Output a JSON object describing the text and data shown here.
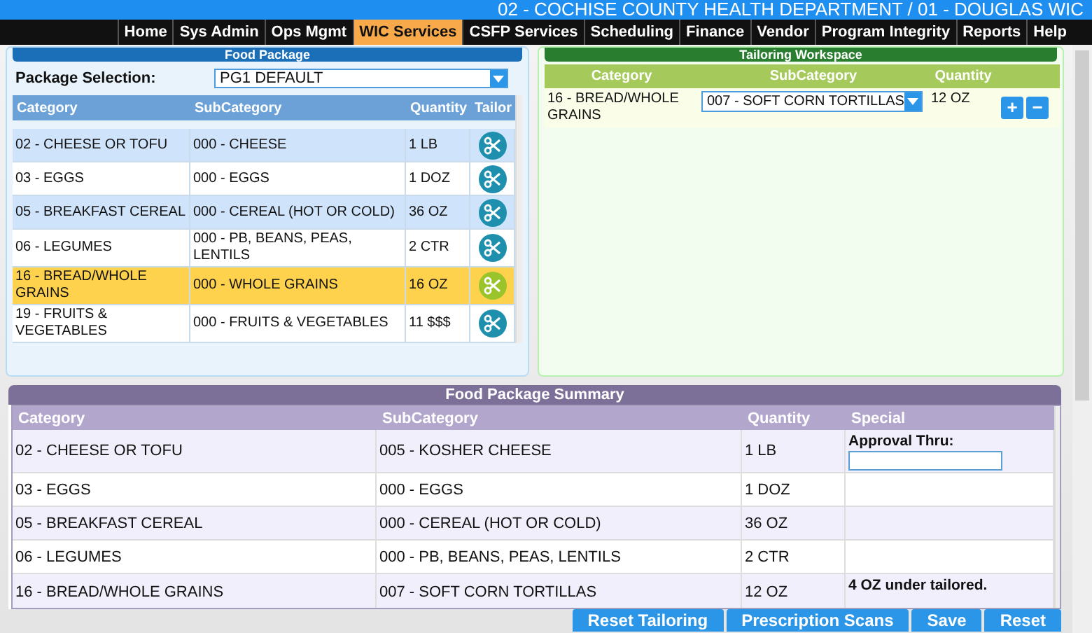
{
  "header": {
    "title": "02 - COCHISE COUNTY HEALTH DEPARTMENT / 01 - DOUGLAS WIC"
  },
  "nav": [
    {
      "label": "Home",
      "selected": false
    },
    {
      "label": "Sys Admin",
      "selected": false
    },
    {
      "label": "Ops Mgmt",
      "selected": false
    },
    {
      "label": "WIC Services",
      "selected": true
    },
    {
      "label": "CSFP Services",
      "selected": false
    },
    {
      "label": "Scheduling",
      "selected": false
    },
    {
      "label": "Finance",
      "selected": false
    },
    {
      "label": "Vendor",
      "selected": false
    },
    {
      "label": "Program Integrity",
      "selected": false
    },
    {
      "label": "Reports",
      "selected": false
    },
    {
      "label": "Help",
      "selected": false
    }
  ],
  "food_package": {
    "title": "Food Package",
    "package_selection": {
      "label": "Package Selection:",
      "value": "PG1 DEFAULT"
    },
    "columns": [
      "Category",
      "SubCategory",
      "Quantity",
      "Tailor"
    ],
    "rows": [
      {
        "category": "02 - CHEESE OR TOFU",
        "subcategory": "000 - CHEESE",
        "quantity": "1 LB",
        "selected": false
      },
      {
        "category": "03 - EGGS",
        "subcategory": "000 - EGGS",
        "quantity": "1 DOZ",
        "selected": false
      },
      {
        "category": "05 - BREAKFAST CEREAL",
        "subcategory": "000 - CEREAL (HOT OR COLD)",
        "quantity": "36 OZ",
        "selected": false
      },
      {
        "category": "06 - LEGUMES",
        "subcategory": "000 - PB, BEANS, PEAS, LENTILS",
        "quantity": "2 CTR",
        "selected": false
      },
      {
        "category": "16 - BREAD/WHOLE GRAINS",
        "subcategory": "000 - WHOLE GRAINS",
        "quantity": "16 OZ",
        "selected": true
      },
      {
        "category": "19 - FRUITS & VEGETABLES",
        "subcategory": "000 - FRUITS & VEGETABLES",
        "quantity": "11 $$$",
        "selected": false
      }
    ]
  },
  "tailoring_workspace": {
    "title": "Tailoring Workspace",
    "columns": [
      "Category",
      "SubCategory",
      "Quantity"
    ],
    "rows": [
      {
        "category": "16 - BREAD/WHOLE GRAINS",
        "subcategory": "007 - SOFT CORN TORTILLAS",
        "quantity": "12 OZ",
        "add": "+",
        "remove": "−"
      }
    ]
  },
  "summary": {
    "title": "Food Package Summary",
    "columns": [
      "Category",
      "SubCategory",
      "Quantity",
      "Special"
    ],
    "rows": [
      {
        "category": "02 - CHEESE OR TOFU",
        "subcategory": "005 - KOSHER CHEESE",
        "quantity": "1 LB",
        "special": {
          "kind": "approval",
          "label": "Approval Thru:"
        }
      },
      {
        "category": "03 - EGGS",
        "subcategory": "000 - EGGS",
        "quantity": "1 DOZ"
      },
      {
        "category": "05 - BREAKFAST CEREAL",
        "subcategory": "000 - CEREAL (HOT OR COLD)",
        "quantity": "36 OZ"
      },
      {
        "category": "06 - LEGUMES",
        "subcategory": "000 - PB, BEANS, PEAS, LENTILS",
        "quantity": "2 CTR"
      },
      {
        "category": "16 - BREAD/WHOLE GRAINS",
        "subcategory": "007 - SOFT CORN TORTILLAS",
        "quantity": "12 OZ",
        "special": {
          "kind": "note",
          "label": "4 OZ under tailored."
        }
      }
    ]
  },
  "buttons": [
    "Reset Tailoring",
    "Prescription Scans",
    "Save",
    "Reset"
  ]
}
